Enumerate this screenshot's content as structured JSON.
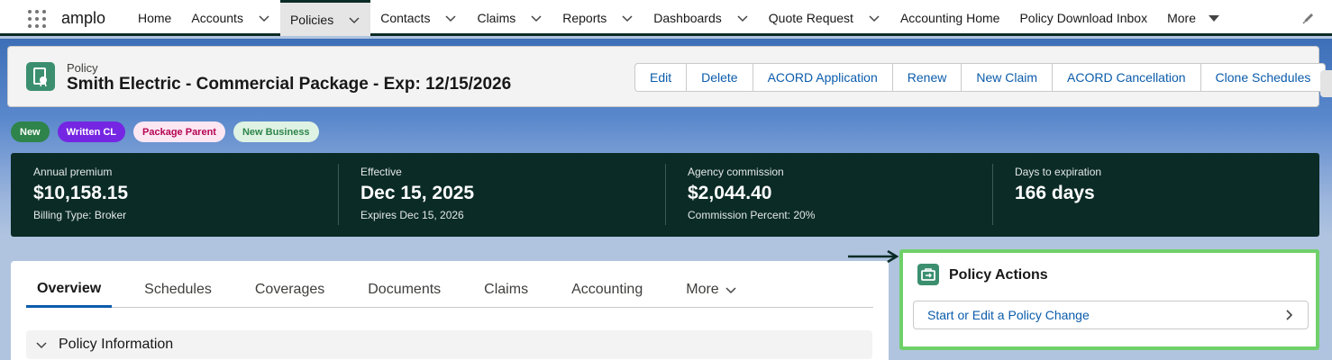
{
  "app": {
    "name": "amplo"
  },
  "nav": {
    "items": [
      {
        "label": "Home",
        "dropdown": false,
        "active": false
      },
      {
        "label": "Accounts",
        "dropdown": true,
        "active": false
      },
      {
        "label": "Policies",
        "dropdown": true,
        "active": true
      },
      {
        "label": "Contacts",
        "dropdown": true,
        "active": false
      },
      {
        "label": "Claims",
        "dropdown": true,
        "active": false
      },
      {
        "label": "Reports",
        "dropdown": true,
        "active": false
      },
      {
        "label": "Dashboards",
        "dropdown": true,
        "active": false
      },
      {
        "label": "Quote Request",
        "dropdown": true,
        "active": false
      },
      {
        "label": "Accounting Home",
        "dropdown": false,
        "active": false
      },
      {
        "label": "Policy Download Inbox",
        "dropdown": false,
        "active": false
      }
    ],
    "more_label": "More"
  },
  "record": {
    "object_label": "Policy",
    "title": "Smith Electric - Commercial Package - Exp: 12/15/2026",
    "actions": [
      "Edit",
      "Delete",
      "ACORD Application",
      "Renew",
      "New Claim",
      "ACORD Cancellation",
      "Clone Schedules"
    ]
  },
  "badges": [
    "New",
    "Written CL",
    "Package Parent",
    "New Business"
  ],
  "stats": [
    {
      "label": "Annual premium",
      "value": "$10,158.15",
      "sub": "Billing Type: Broker"
    },
    {
      "label": "Effective",
      "value": "Dec 15, 2025",
      "sub": "Expires Dec 15, 2026"
    },
    {
      "label": "Agency commission",
      "value": "$2,044.40",
      "sub": "Commission Percent: 20%"
    },
    {
      "label": "Days to expiration",
      "value": "166 days",
      "sub": ""
    }
  ],
  "tabs": {
    "items": [
      "Overview",
      "Schedules",
      "Coverages",
      "Documents",
      "Claims",
      "Accounting"
    ],
    "more_label": "More",
    "active": "Overview"
  },
  "section": {
    "title": "Policy Information"
  },
  "policy_actions": {
    "title": "Policy Actions",
    "button_label": "Start or Edit a Policy Change"
  },
  "colors": {
    "nav_accent": "#0b2b26",
    "link": "#0b5cab",
    "highlight_border": "#6fd06a",
    "badge_new": "#2e844a",
    "badge_written": "#7526e3"
  }
}
